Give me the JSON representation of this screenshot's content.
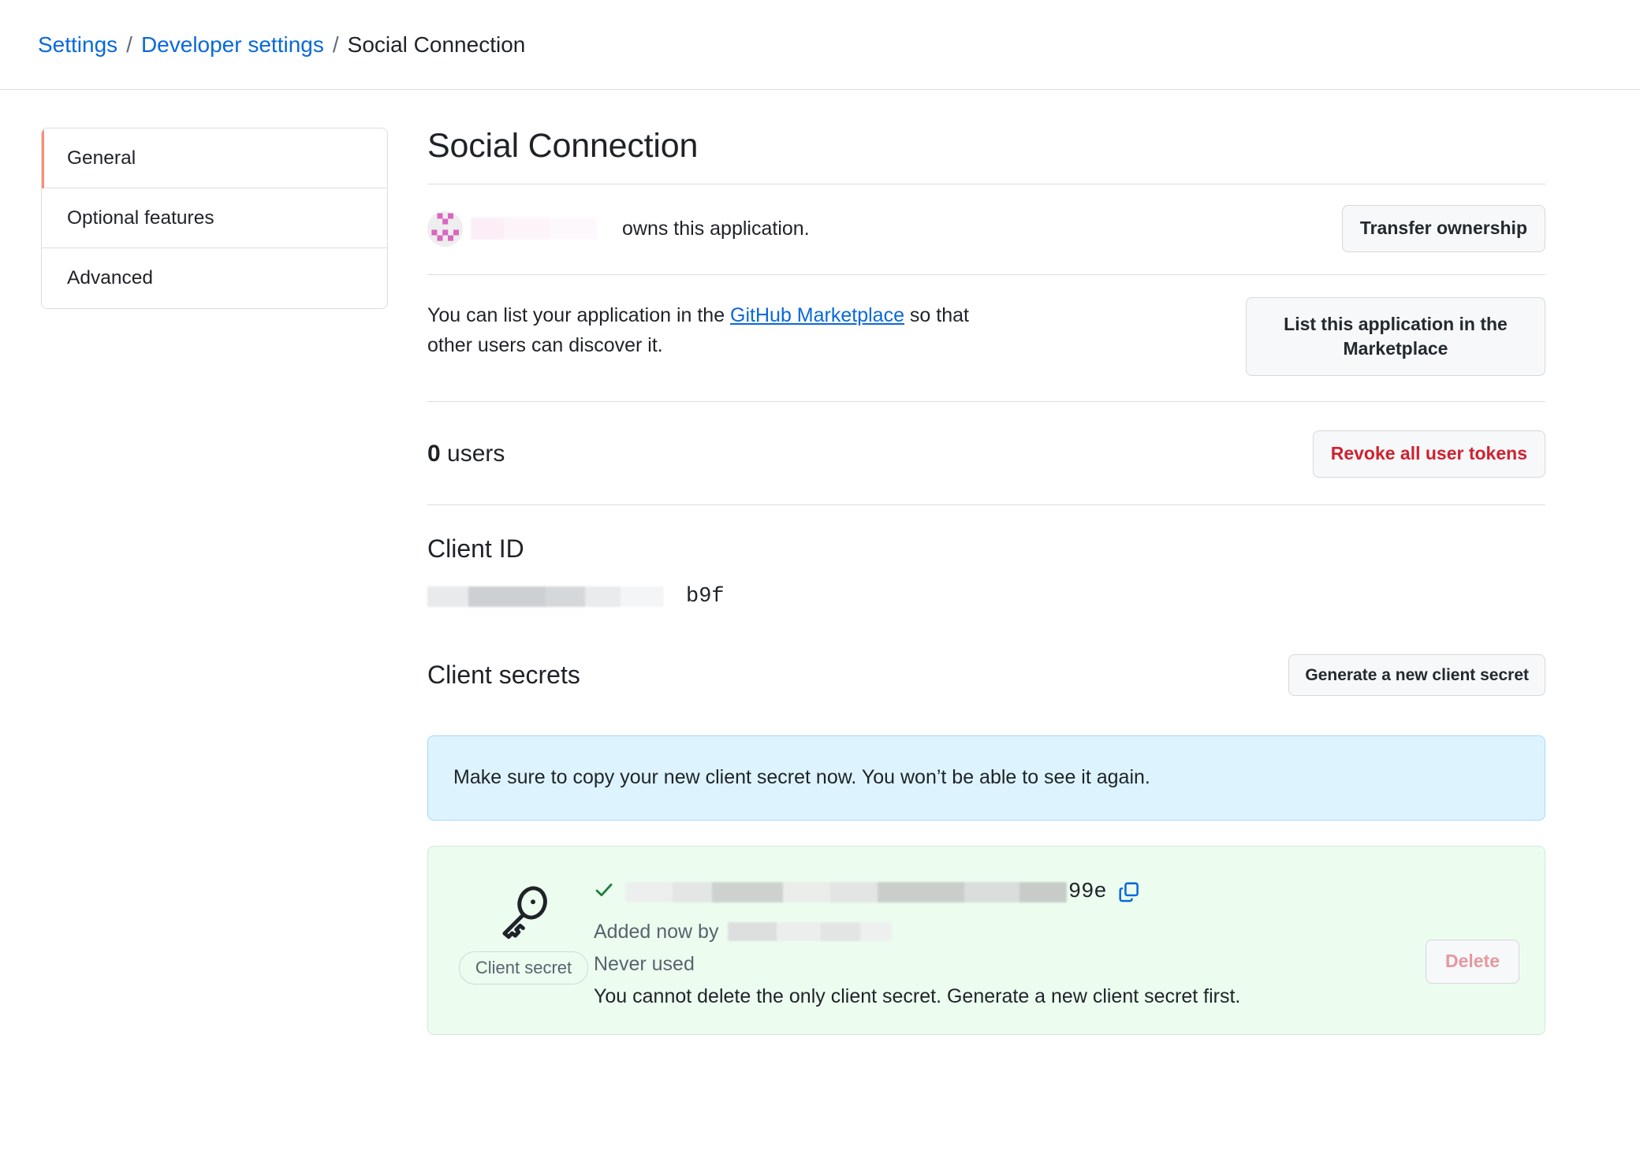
{
  "breadcrumb": {
    "settings": "Settings",
    "developer_settings": "Developer settings",
    "current": "Social Connection",
    "separator": "/"
  },
  "sidebar": {
    "items": [
      {
        "label": "General",
        "selected": true
      },
      {
        "label": "Optional features",
        "selected": false
      },
      {
        "label": "Advanced",
        "selected": false
      }
    ]
  },
  "main": {
    "title": "Social Connection",
    "owner": {
      "owns_text": "owns this application.",
      "transfer_button": "Transfer ownership",
      "name_redacted": true
    },
    "marketplace": {
      "text_before": "You can list your application in the ",
      "link": "GitHub Marketplace",
      "text_after": " so that other users can discover it.",
      "button": "List this application in the Marketplace"
    },
    "users": {
      "count": "0",
      "label": "users",
      "revoke_button": "Revoke all user tokens"
    },
    "client_id": {
      "heading": "Client ID",
      "value_tail": "b9f"
    },
    "client_secrets": {
      "heading": "Client secrets",
      "generate_button": "Generate a new client secret",
      "flash_message": "Make sure to copy your new client secret now. You won’t be able to see it again.",
      "secret": {
        "badge": "Client secret",
        "value_tail": "99e",
        "added_by_prefix": "Added now by",
        "never_used": "Never used",
        "cannot_delete": "You cannot delete the only client secret. Generate a new client secret first.",
        "delete_button": "Delete",
        "copy_icon": "copy-icon",
        "check_icon": "check-icon",
        "key_icon": "key-icon"
      }
    }
  },
  "colors": {
    "link": "#0969da",
    "danger": "#cf222e",
    "selected_indicator": "#fd8c73",
    "flash_info_bg": "#ddf4ff",
    "secret_card_bg": "#ecfdf0",
    "check_green": "#1a7f37",
    "avatar_pattern": "#d867c0"
  }
}
